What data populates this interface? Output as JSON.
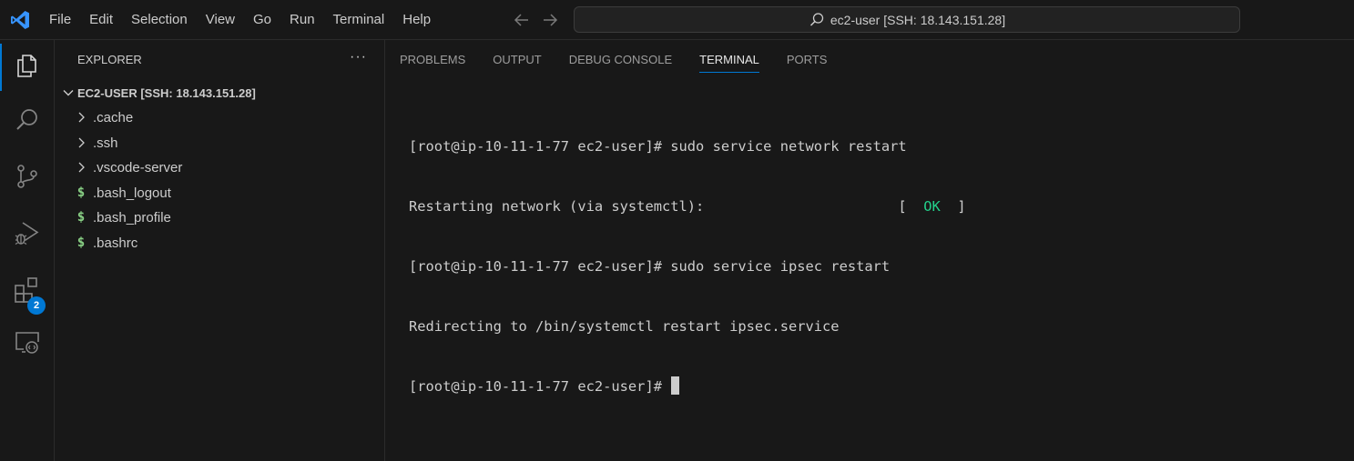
{
  "titlebar": {
    "menu": [
      "File",
      "Edit",
      "Selection",
      "View",
      "Go",
      "Run",
      "Terminal",
      "Help"
    ],
    "command_center": "ec2-user [SSH: 18.143.151.28]"
  },
  "activitybar": {
    "items": [
      {
        "icon": "explorer-icon",
        "active": true
      },
      {
        "icon": "search-icon"
      },
      {
        "icon": "source-control-icon"
      },
      {
        "icon": "run-debug-icon"
      },
      {
        "icon": "extensions-icon",
        "badge": "2"
      },
      {
        "icon": "remote-explorer-icon"
      }
    ],
    "extensions_badge": "2",
    "accent": "#0078d4"
  },
  "sidebar": {
    "title": "EXPLORER",
    "more": "···",
    "root": "EC2-USER [SSH: 18.143.151.28]",
    "items": [
      {
        "type": "folder",
        "label": ".cache"
      },
      {
        "type": "folder",
        "label": ".ssh"
      },
      {
        "type": "folder",
        "label": ".vscode-server"
      },
      {
        "type": "file",
        "icon": "shell-dollar-icon",
        "label": ".bash_logout"
      },
      {
        "type": "file",
        "icon": "shell-dollar-icon",
        "label": ".bash_profile"
      },
      {
        "type": "file",
        "icon": "shell-dollar-icon",
        "label": ".bashrc"
      }
    ]
  },
  "panel": {
    "tabs": [
      "PROBLEMS",
      "OUTPUT",
      "DEBUG CONSOLE",
      "TERMINAL",
      "PORTS"
    ],
    "active_tab": "TERMINAL",
    "terminal": {
      "line1": "[root@ip-10-11-1-77 ec2-user]# sudo service network restart",
      "line2_prefix": "Restarting network (via systemctl):                       [  ",
      "line2_ok": "OK",
      "line2_suffix": "  ]",
      "line3": "[root@ip-10-11-1-77 ec2-user]# sudo service ipsec restart",
      "line4": "Redirecting to /bin/systemctl restart ipsec.service",
      "line5": "[root@ip-10-11-1-77 ec2-user]# "
    },
    "ok_color": "#23d18b"
  }
}
